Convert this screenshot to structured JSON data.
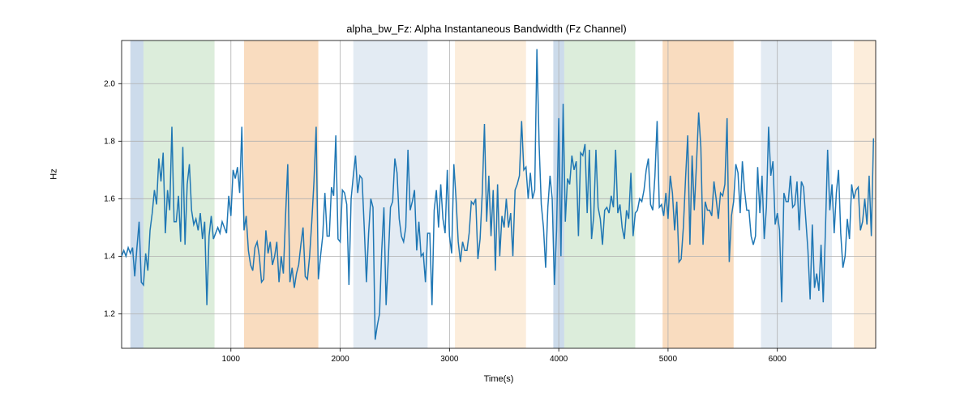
{
  "chart_data": {
    "type": "line",
    "title": "alpha_bw_Fz: Alpha Instantaneous Bandwidth (Fz Channel)",
    "xlabel": "Time(s)",
    "ylabel": "Hz",
    "xlim": [
      0,
      6900
    ],
    "ylim": [
      1.08,
      2.15
    ],
    "xticks": [
      1000,
      2000,
      3000,
      4000,
      5000,
      6000
    ],
    "yticks": [
      1.2,
      1.4,
      1.6,
      1.8,
      2.0
    ],
    "line_color": "#1f77b4",
    "regions": [
      {
        "x0": 80,
        "x1": 200,
        "color": "#b1c8e0"
      },
      {
        "x0": 200,
        "x1": 850,
        "color": "#c9e3c8"
      },
      {
        "x0": 1120,
        "x1": 1800,
        "color": "#f6c99c"
      },
      {
        "x0": 2120,
        "x1": 2800,
        "color": "#d4e1ed"
      },
      {
        "x0": 3050,
        "x1": 3700,
        "color": "#fbe3c7"
      },
      {
        "x0": 3950,
        "x1": 4050,
        "color": "#b1c8e0"
      },
      {
        "x0": 4050,
        "x1": 4700,
        "color": "#c9e3c8"
      },
      {
        "x0": 4950,
        "x1": 5600,
        "color": "#f6c99c"
      },
      {
        "x0": 5850,
        "x1": 6500,
        "color": "#d4e1ed"
      },
      {
        "x0": 6700,
        "x1": 6900,
        "color": "#fbe3c7"
      }
    ],
    "x": [
      0,
      20,
      40,
      60,
      80,
      100,
      120,
      140,
      160,
      180,
      200,
      220,
      240,
      260,
      280,
      300,
      320,
      340,
      360,
      380,
      400,
      420,
      440,
      460,
      480,
      500,
      520,
      540,
      560,
      580,
      600,
      620,
      640,
      660,
      680,
      700,
      720,
      740,
      760,
      780,
      800,
      820,
      840,
      860,
      880,
      900,
      920,
      940,
      960,
      980,
      1000,
      1020,
      1040,
      1060,
      1080,
      1100,
      1120,
      1140,
      1160,
      1180,
      1200,
      1220,
      1240,
      1260,
      1280,
      1300,
      1320,
      1340,
      1360,
      1380,
      1400,
      1420,
      1440,
      1460,
      1480,
      1500,
      1520,
      1540,
      1560,
      1580,
      1600,
      1620,
      1640,
      1660,
      1680,
      1700,
      1720,
      1740,
      1760,
      1780,
      1800,
      1820,
      1840,
      1860,
      1880,
      1900,
      1920,
      1940,
      1960,
      1980,
      2000,
      2020,
      2040,
      2060,
      2080,
      2100,
      2120,
      2140,
      2160,
      2180,
      2200,
      2220,
      2240,
      2260,
      2280,
      2300,
      2320,
      2340,
      2360,
      2380,
      2400,
      2420,
      2440,
      2460,
      2480,
      2500,
      2520,
      2540,
      2560,
      2580,
      2600,
      2620,
      2640,
      2660,
      2680,
      2700,
      2720,
      2740,
      2760,
      2780,
      2800,
      2820,
      2840,
      2860,
      2880,
      2900,
      2920,
      2940,
      2960,
      2980,
      3000,
      3020,
      3040,
      3060,
      3080,
      3100,
      3120,
      3140,
      3160,
      3180,
      3200,
      3220,
      3240,
      3260,
      3280,
      3300,
      3320,
      3340,
      3360,
      3380,
      3400,
      3420,
      3440,
      3460,
      3480,
      3500,
      3520,
      3540,
      3560,
      3580,
      3600,
      3620,
      3640,
      3660,
      3680,
      3700,
      3720,
      3740,
      3760,
      3780,
      3800,
      3820,
      3840,
      3860,
      3880,
      3900,
      3920,
      3940,
      3960,
      3980,
      4000,
      4020,
      4040,
      4060,
      4080,
      4100,
      4120,
      4140,
      4160,
      4180,
      4200,
      4220,
      4240,
      4260,
      4280,
      4300,
      4320,
      4340,
      4360,
      4380,
      4400,
      4420,
      4440,
      4460,
      4480,
      4500,
      4520,
      4540,
      4560,
      4580,
      4600,
      4620,
      4640,
      4660,
      4680,
      4700,
      4720,
      4740,
      4760,
      4780,
      4800,
      4820,
      4840,
      4860,
      4880,
      4900,
      4920,
      4940,
      4960,
      4980,
      5000,
      5020,
      5040,
      5060,
      5080,
      5100,
      5120,
      5140,
      5160,
      5180,
      5200,
      5220,
      5240,
      5260,
      5280,
      5300,
      5320,
      5340,
      5360,
      5380,
      5400,
      5420,
      5440,
      5460,
      5480,
      5500,
      5520,
      5540,
      5560,
      5580,
      5600,
      5620,
      5640,
      5660,
      5680,
      5700,
      5720,
      5740,
      5760,
      5780,
      5800,
      5820,
      5840,
      5860,
      5880,
      5900,
      5920,
      5940,
      5960,
      5980,
      6000,
      6020,
      6040,
      6060,
      6080,
      6100,
      6120,
      6140,
      6160,
      6180,
      6200,
      6220,
      6240,
      6260,
      6280,
      6300,
      6320,
      6340,
      6360,
      6380,
      6400,
      6420,
      6440,
      6460,
      6480,
      6500,
      6520,
      6540,
      6560,
      6580,
      6600,
      6620,
      6640,
      6660,
      6680,
      6700,
      6720,
      6740,
      6760,
      6780,
      6800,
      6820,
      6840,
      6860,
      6880,
      6900
    ],
    "y": [
      1.4,
      1.42,
      1.4,
      1.43,
      1.41,
      1.43,
      1.33,
      1.43,
      1.52,
      1.31,
      1.3,
      1.41,
      1.35,
      1.49,
      1.55,
      1.63,
      1.58,
      1.74,
      1.66,
      1.76,
      1.48,
      1.63,
      1.56,
      1.85,
      1.52,
      1.52,
      1.61,
      1.45,
      1.78,
      1.44,
      1.65,
      1.72,
      1.56,
      1.51,
      1.53,
      1.49,
      1.55,
      1.46,
      1.52,
      1.23,
      1.47,
      1.54,
      1.46,
      1.48,
      1.5,
      1.48,
      1.52,
      1.5,
      1.48,
      1.61,
      1.54,
      1.7,
      1.67,
      1.71,
      1.62,
      1.85,
      1.49,
      1.54,
      1.42,
      1.37,
      1.35,
      1.43,
      1.45,
      1.4,
      1.31,
      1.32,
      1.49,
      1.41,
      1.45,
      1.37,
      1.4,
      1.45,
      1.31,
      1.4,
      1.34,
      1.54,
      1.72,
      1.31,
      1.36,
      1.29,
      1.34,
      1.37,
      1.44,
      1.5,
      1.33,
      1.32,
      1.4,
      1.52,
      1.66,
      1.85,
      1.32,
      1.4,
      1.47,
      1.62,
      1.47,
      1.47,
      1.64,
      1.61,
      1.82,
      1.46,
      1.45,
      1.63,
      1.62,
      1.58,
      1.3,
      1.6,
      1.68,
      1.75,
      1.62,
      1.68,
      1.67,
      1.5,
      1.31,
      1.48,
      1.6,
      1.57,
      1.11,
      1.16,
      1.2,
      1.42,
      1.57,
      1.23,
      1.39,
      1.57,
      1.59,
      1.74,
      1.69,
      1.53,
      1.47,
      1.45,
      1.5,
      1.77,
      1.56,
      1.59,
      1.63,
      1.42,
      1.52,
      1.4,
      1.41,
      1.31,
      1.48,
      1.48,
      1.23,
      1.56,
      1.63,
      1.5,
      1.65,
      1.53,
      1.48,
      1.7,
      1.47,
      1.41,
      1.72,
      1.6,
      1.45,
      1.38,
      1.45,
      1.42,
      1.42,
      1.48,
      1.59,
      1.58,
      1.6,
      1.39,
      1.46,
      1.62,
      1.86,
      1.52,
      1.68,
      1.47,
      1.63,
      1.35,
      1.65,
      1.4,
      1.54,
      1.5,
      1.6,
      1.5,
      1.55,
      1.4,
      1.63,
      1.65,
      1.68,
      1.87,
      1.7,
      1.71,
      1.6,
      1.69,
      1.6,
      1.63,
      2.12,
      1.79,
      1.58,
      1.5,
      1.36,
      1.57,
      1.68,
      1.6,
      1.3,
      1.49,
      1.88,
      1.4,
      1.93,
      1.52,
      1.67,
      1.65,
      1.75,
      1.7,
      1.73,
      1.47,
      1.76,
      1.75,
      1.79,
      1.55,
      1.77,
      1.46,
      1.54,
      1.77,
      1.57,
      1.53,
      1.44,
      1.56,
      1.57,
      1.55,
      1.61,
      1.57,
      1.77,
      1.55,
      1.58,
      1.5,
      1.46,
      1.56,
      1.53,
      1.69,
      1.47,
      1.55,
      1.56,
      1.6,
      1.59,
      1.63,
      1.7,
      1.74,
      1.58,
      1.56,
      1.68,
      1.87,
      1.57,
      1.58,
      1.54,
      1.62,
      1.53,
      1.68,
      1.62,
      1.49,
      1.59,
      1.38,
      1.39,
      1.5,
      1.67,
      1.82,
      1.44,
      1.75,
      1.56,
      1.72,
      1.9,
      1.78,
      1.44,
      1.59,
      1.56,
      1.56,
      1.54,
      1.66,
      1.6,
      1.53,
      1.62,
      1.61,
      1.65,
      1.88,
      1.38,
      1.54,
      1.59,
      1.72,
      1.69,
      1.55,
      1.73,
      1.63,
      1.56,
      1.56,
      1.47,
      1.44,
      1.47,
      1.71,
      1.55,
      1.68,
      1.46,
      1.57,
      1.85,
      1.68,
      1.73,
      1.51,
      1.55,
      1.49,
      1.24,
      1.62,
      1.59,
      1.59,
      1.68,
      1.57,
      1.58,
      1.66,
      1.49,
      1.66,
      1.64,
      1.53,
      1.42,
      1.25,
      1.51,
      1.29,
      1.34,
      1.28,
      1.44,
      1.24,
      1.49,
      1.77,
      1.56,
      1.65,
      1.48,
      1.62,
      1.7,
      1.48,
      1.36,
      1.4,
      1.53,
      1.46,
      1.65,
      1.6,
      1.63,
      1.64,
      1.49,
      1.52,
      1.6,
      1.51,
      1.68,
      1.47,
      1.81
    ]
  }
}
